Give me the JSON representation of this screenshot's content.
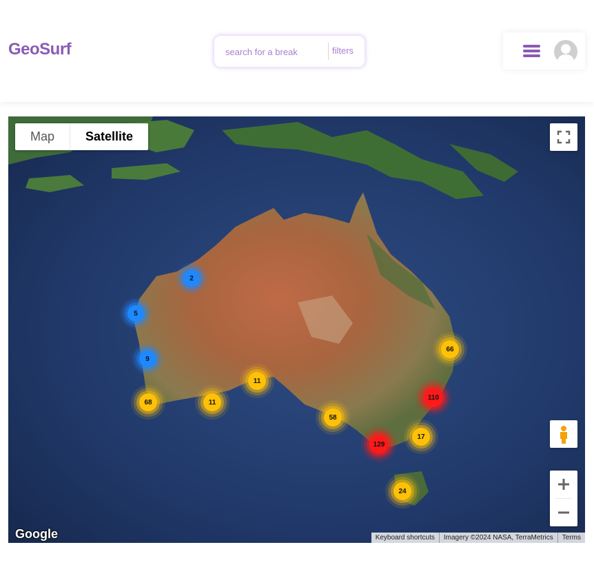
{
  "header": {
    "logo": "GeoSurf",
    "search_placeholder": "search for a break",
    "filters_label": "filters"
  },
  "map": {
    "type_options": [
      "Map",
      "Satellite"
    ],
    "selected_type": "Satellite",
    "google_logo": "Google",
    "attribution": {
      "shortcuts": "Keyboard shortcuts",
      "imagery": "Imagery ©2024 NASA, TerraMetrics",
      "terms": "Terms"
    },
    "clusters": [
      {
        "count": "2",
        "level": "blue"
      },
      {
        "count": "5",
        "level": "blue"
      },
      {
        "count": "9",
        "level": "blue"
      },
      {
        "count": "68",
        "level": "yellow"
      },
      {
        "count": "11",
        "level": "yellow"
      },
      {
        "count": "11",
        "level": "yellow"
      },
      {
        "count": "58",
        "level": "yellow"
      },
      {
        "count": "66",
        "level": "yellow"
      },
      {
        "count": "110",
        "level": "red"
      },
      {
        "count": "17",
        "level": "yellow"
      },
      {
        "count": "129",
        "level": "red"
      },
      {
        "count": "24",
        "level": "yellow"
      }
    ],
    "icons": [
      "fullscreen-icon",
      "pegman-icon",
      "zoom-in-icon",
      "zoom-out-icon"
    ]
  },
  "colors": {
    "brand": "#8a5bb5",
    "cluster_blue": "#1e88ff",
    "cluster_yellow": "#ffc107",
    "cluster_red": "#ff1a1a"
  }
}
